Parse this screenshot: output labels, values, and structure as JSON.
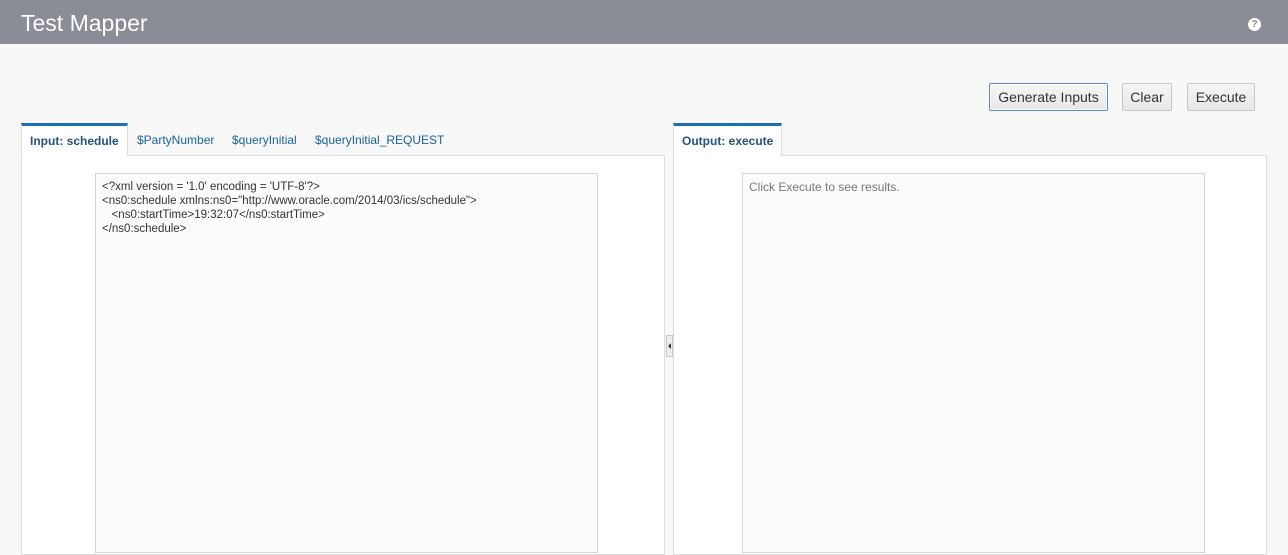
{
  "header": {
    "title": "Test Mapper",
    "help_icon": "?"
  },
  "toolbar": {
    "generate_label": "Generate Inputs",
    "clear_label": "Clear",
    "execute_label": "Execute"
  },
  "input_panel": {
    "tabs": [
      {
        "label": "Input: schedule",
        "active": true
      },
      {
        "label": "$PartyNumber",
        "active": false
      },
      {
        "label": "$queryInitial",
        "active": false
      },
      {
        "label": "$queryInitial_REQUEST",
        "active": false
      }
    ],
    "content": "<?xml version = '1.0' encoding = 'UTF-8'?>\n<ns0:schedule xmlns:ns0=\"http://www.oracle.com/2014/03/ics/schedule\">\n   <ns0:startTime>19:32:07</ns0:startTime>\n</ns0:schedule>"
  },
  "output_panel": {
    "tabs": [
      {
        "label": "Output: execute",
        "active": true
      }
    ],
    "placeholder": "Click Execute to see results."
  },
  "colors": {
    "header_bg": "#8a8c96",
    "accent": "#1f6fb3",
    "link": "#1a62a0"
  }
}
